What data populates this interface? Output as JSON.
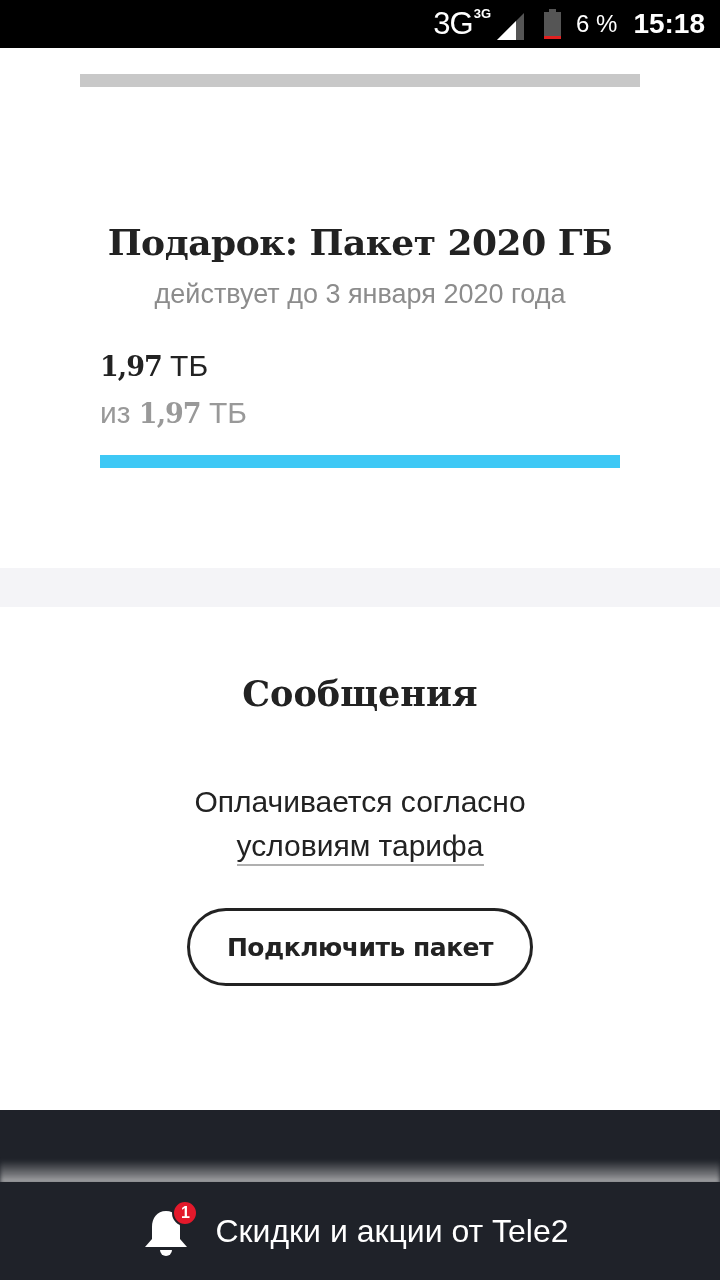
{
  "status_bar": {
    "network": "3G",
    "network_badge": "3G",
    "battery": "6 %",
    "time": "15:18"
  },
  "package": {
    "title": "Подарок: Пакет 2020 ГБ",
    "validity": "действует до 3 января 2020 года",
    "remaining": "**1,97** ТБ",
    "total": "из **1,97** ТБ",
    "level": 1
  },
  "messages": {
    "title": "Сообщения",
    "text": "Оплачивается согласно",
    "link": "условиям тарифа",
    "button": "Подключить пакет"
  },
  "notification_bar": {
    "badge": "1",
    "text": "Скидки и акции от Tele2"
  }
}
